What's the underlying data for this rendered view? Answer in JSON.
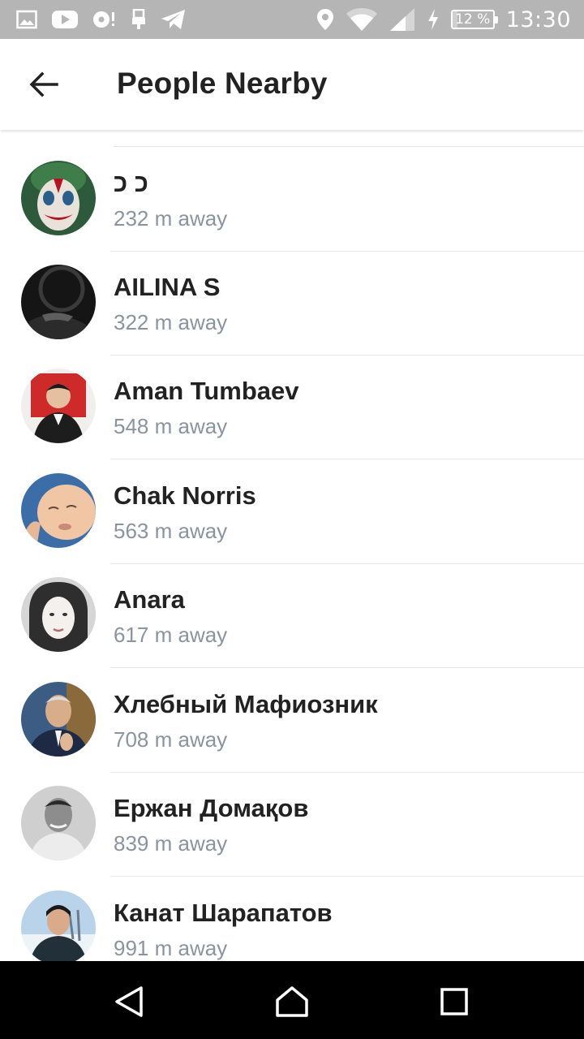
{
  "status_bar": {
    "time": "13:30",
    "battery_percent": 12,
    "battery_label": "12 %",
    "left_icons": [
      "gallery-icon",
      "youtube-icon",
      "voice-recorder-icon",
      "usb-icon",
      "telegram-icon"
    ],
    "right_icons": [
      "location-icon",
      "wifi-icon",
      "cellular-signal-icon",
      "charging-icon",
      "battery-icon"
    ]
  },
  "app_bar": {
    "title": "People Nearby",
    "back_icon": "arrow-left-icon"
  },
  "people": [
    {
      "name": "כ כ",
      "distance": "232 m away"
    },
    {
      "name": "AILINA S",
      "distance": "322 m away"
    },
    {
      "name": "Aman Tumbaev",
      "distance": "548 m away"
    },
    {
      "name": "Chak Norris",
      "distance": "563 m away"
    },
    {
      "name": "Anara",
      "distance": "617 m away"
    },
    {
      "name": "Хлебный Мафиозник",
      "distance": "708 m away"
    },
    {
      "name": "Ержан Домақов",
      "distance": "839 m away"
    },
    {
      "name": "Канат Шарапатов",
      "distance": "991 m away"
    }
  ],
  "nav_bar": {
    "icons": [
      "back-triangle-icon",
      "home-icon",
      "recents-icon"
    ]
  },
  "colors": {
    "status_bar_bg": "#b5b5b5",
    "text_primary": "#222222",
    "text_secondary": "#8a949e",
    "divider": "#e8e8e8",
    "nav_bar_bg": "#000000"
  }
}
